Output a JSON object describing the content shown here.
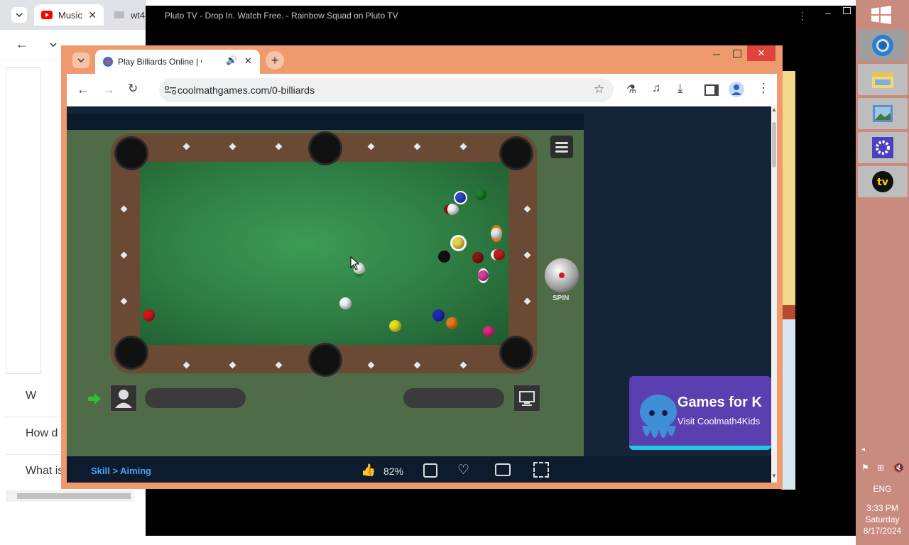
{
  "background_window": {
    "tabs": [
      {
        "label": "Music",
        "icon": "youtube-icon"
      },
      {
        "label": "wt4",
        "icon": "image-icon"
      }
    ],
    "links": [
      "W",
      "How d",
      "What is"
    ]
  },
  "pluto_window": {
    "title": "Pluto TV - Drop In. Watch Free. - Rainbow Squad on Pluto TV"
  },
  "browser": {
    "tab_title": "Play Billiards Online | Coolm",
    "url": "coolmathgames.com/0-billiards"
  },
  "game": {
    "spin_label": "SPIN",
    "breadcrumb": "Skill > Aiming",
    "rating": "82%",
    "ad": {
      "title": "Games for K",
      "subtitle": "Visit Coolmath4Kids"
    }
  },
  "taskbar": {
    "language": "ENG",
    "time": "3:33 PM",
    "day": "Saturday",
    "date": "8/17/2024",
    "apps": [
      "chrome-icon",
      "file-explorer-icon",
      "photos-icon",
      "settings-icon",
      "pluto-tv-icon"
    ]
  },
  "colors": {
    "window_frame": "#ef9a6c",
    "felt": "#2e7c42",
    "rail": "#6a4a35",
    "taskbar": "#c98b7e"
  }
}
